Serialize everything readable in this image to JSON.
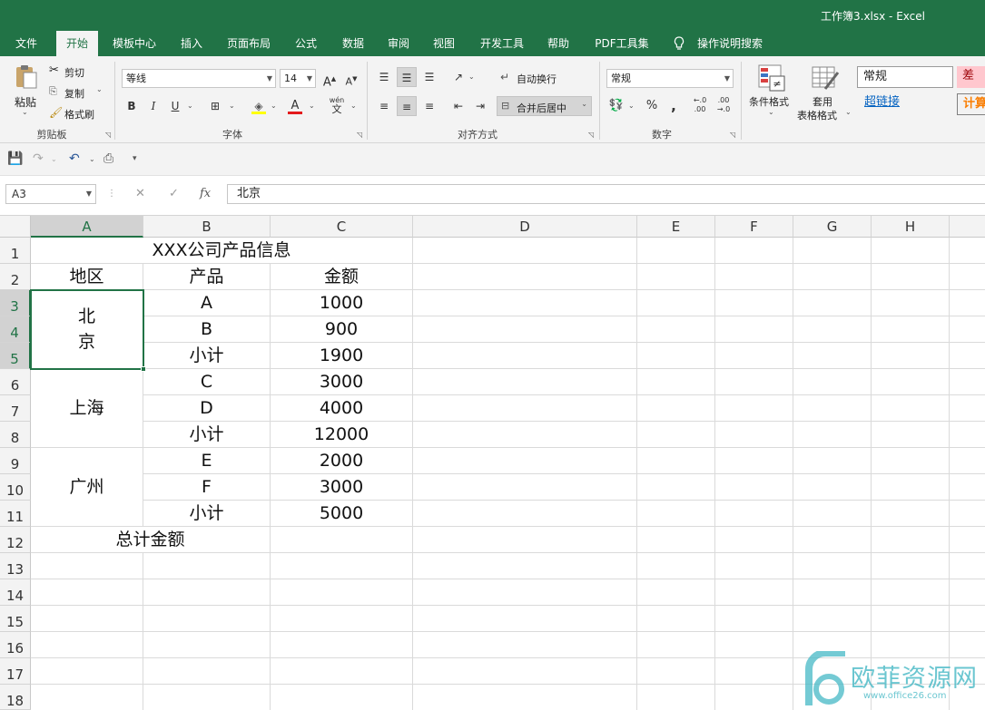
{
  "window": {
    "title": "工作簿3.xlsx  -  Excel"
  },
  "menu": [
    "文件",
    "开始",
    "模板中心",
    "插入",
    "页面布局",
    "公式",
    "数据",
    "审阅",
    "视图",
    "开发工具",
    "帮助",
    "PDF工具集"
  ],
  "tell_me": "操作说明搜索",
  "ribbon": {
    "clipboard": {
      "paste": "粘贴",
      "cut": "剪切",
      "copy": "复制",
      "format_painter": "格式刷",
      "label": "剪贴板"
    },
    "font": {
      "name": "等线",
      "size": "14",
      "grow": "A",
      "shrink": "A",
      "bold": "B",
      "italic": "I",
      "underline": "U",
      "wen": "wén",
      "label": "字体"
    },
    "alignment": {
      "wrap": "自动换行",
      "merge": "合并后居中",
      "label": "对齐方式"
    },
    "number": {
      "format": "常规",
      "percent": "%",
      "comma": ",",
      "inc_dec": "←.0\n.00",
      "dec_dec": ".00\n→.0",
      "label": "数字"
    },
    "styles": {
      "conditional_top": "条件格式",
      "table_top": "套用",
      "table_bottom": "表格格式",
      "normal": "常规",
      "bad": "差",
      "hyperlink": "超链接",
      "calc": "计算"
    }
  },
  "formula_bar": {
    "name_box": "A3",
    "cancel": "✕",
    "enter": "✓",
    "fx": "fx",
    "content": "北京"
  },
  "columns": [
    "A",
    "B",
    "C",
    "D",
    "E",
    "F",
    "G",
    "H"
  ],
  "rows": [
    "1",
    "2",
    "3",
    "4",
    "5",
    "6",
    "7",
    "8",
    "9",
    "10",
    "11",
    "12",
    "13",
    "14",
    "15",
    "16",
    "17",
    "18"
  ],
  "sheet": {
    "title": "XXX公司产品信息",
    "header_region": "地区",
    "header_product": "产品",
    "header_amount": "金额",
    "region_beijing_1": "北",
    "region_beijing_2": "京",
    "region_shanghai": "上海",
    "region_guangzhou": "广州",
    "products": [
      "A",
      "B",
      "小计",
      "C",
      "D",
      "小计",
      "E",
      "F",
      "小计"
    ],
    "amounts": [
      "1000",
      "900",
      "1900",
      "3000",
      "4000",
      "12000",
      "2000",
      "3000",
      "5000"
    ],
    "total_label": "总计金额"
  },
  "watermark": {
    "text": "欧菲资源网",
    "url": "www.office26.com",
    "color": "#46b8c5"
  },
  "colors": {
    "excel_green": "#217346"
  }
}
